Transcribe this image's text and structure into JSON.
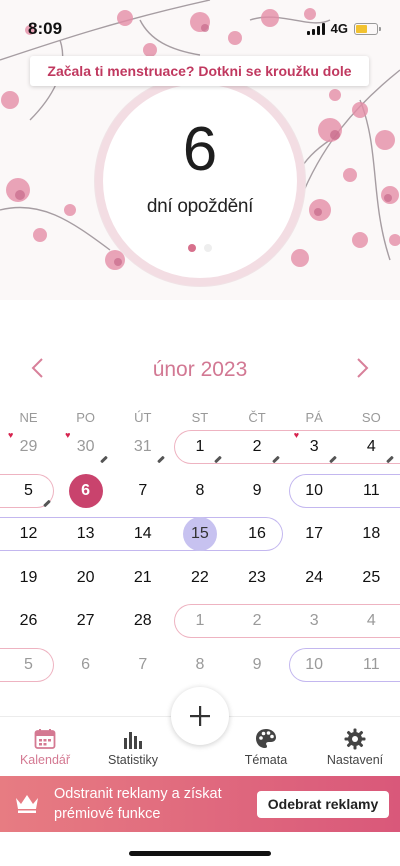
{
  "status_bar": {
    "time": "8:09",
    "network": "4G"
  },
  "prompt_banner": "Začala ti menstruace? Dotkni se kroužku dole",
  "cycle": {
    "number": "6",
    "label": "dní opoždění",
    "page_count": 2,
    "active_page": 0
  },
  "calendar": {
    "month_title": "únor 2023",
    "prev_icon": "chevron-left-icon",
    "next_icon": "chevron-right-icon",
    "weekdays": [
      "NE",
      "PO",
      "ÚT",
      "ST",
      "ČT",
      "PÁ",
      "SO"
    ],
    "weeks": [
      [
        {
          "d": "29",
          "m": true,
          "heart": true
        },
        {
          "d": "30",
          "m": true,
          "heart": true,
          "note": true
        },
        {
          "d": "31",
          "m": true,
          "note": true
        },
        {
          "d": "1",
          "note": true
        },
        {
          "d": "2",
          "note": true
        },
        {
          "d": "3",
          "heart": true,
          "note": true
        },
        {
          "d": "4",
          "note": true
        }
      ],
      [
        {
          "d": "5",
          "note": true
        },
        {
          "d": "6",
          "today": true
        },
        {
          "d": "7"
        },
        {
          "d": "8"
        },
        {
          "d": "9"
        },
        {
          "d": "10"
        },
        {
          "d": "11"
        }
      ],
      [
        {
          "d": "12"
        },
        {
          "d": "13"
        },
        {
          "d": "14"
        },
        {
          "d": "15",
          "ovulation": true
        },
        {
          "d": "16"
        },
        {
          "d": "17"
        },
        {
          "d": "18"
        }
      ],
      [
        {
          "d": "19"
        },
        {
          "d": "20"
        },
        {
          "d": "21"
        },
        {
          "d": "22"
        },
        {
          "d": "23"
        },
        {
          "d": "24"
        },
        {
          "d": "25"
        }
      ],
      [
        {
          "d": "26"
        },
        {
          "d": "27"
        },
        {
          "d": "28"
        },
        {
          "d": "1",
          "m": true
        },
        {
          "d": "2",
          "m": true
        },
        {
          "d": "3",
          "m": true
        },
        {
          "d": "4",
          "m": true
        }
      ],
      [
        {
          "d": "5",
          "m": true
        },
        {
          "d": "6",
          "m": true
        },
        {
          "d": "7",
          "m": true
        },
        {
          "d": "8",
          "m": true
        },
        {
          "d": "9",
          "m": true
        },
        {
          "d": "10",
          "m": true
        },
        {
          "d": "11",
          "m": true
        }
      ]
    ],
    "ranges": [
      {
        "row": 0,
        "from": 3,
        "to": 6,
        "color": "pink",
        "open_right": true
      },
      {
        "row": 1,
        "from": 0,
        "to": 0,
        "color": "pink",
        "open_left": true
      },
      {
        "row": 1,
        "from": 5,
        "to": 6,
        "color": "purple",
        "open_right": true
      },
      {
        "row": 2,
        "from": 0,
        "to": 4,
        "color": "purple",
        "open_left": true
      },
      {
        "row": 4,
        "from": 3,
        "to": 6,
        "color": "pink",
        "open_right": true
      },
      {
        "row": 5,
        "from": 0,
        "to": 0,
        "color": "pink",
        "open_left": true
      },
      {
        "row": 5,
        "from": 5,
        "to": 6,
        "color": "purple",
        "open_right": true
      }
    ],
    "colors": {
      "accent": "#d27893",
      "today": "#c9436d",
      "ovulation": "#c7c2f0",
      "period_outline": "#eeb3c1",
      "fertile_outline": "#c3b7ef"
    }
  },
  "add_button": {
    "icon": "plus-icon"
  },
  "bottom_nav": [
    {
      "label": "Kalendář",
      "icon": "calendar-icon",
      "active": true
    },
    {
      "label": "Statistiky",
      "icon": "bar-chart-icon",
      "active": false
    },
    {
      "label": "Témata",
      "icon": "palette-icon",
      "active": false
    },
    {
      "label": "Nastavení",
      "icon": "gear-icon",
      "active": false
    }
  ],
  "promo": {
    "icon": "crown-icon",
    "text": "Odstranit reklamy a získat prémiové funkce",
    "button": "Odebrat reklamy"
  }
}
